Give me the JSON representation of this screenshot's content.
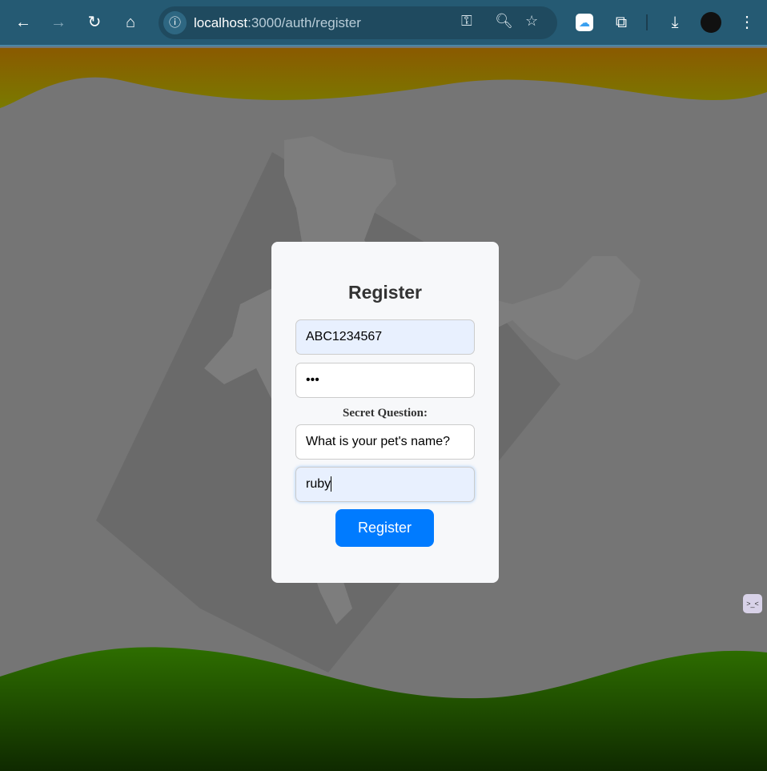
{
  "browser": {
    "url_host": "localhost",
    "url_rest": ":3000/auth/register"
  },
  "form": {
    "title": "Register",
    "username_value": "ABC1234567",
    "password_value": "•••",
    "secret_question_label": "Secret Question:",
    "secret_question_value": "What is your pet's name?",
    "secret_answer_value": "ruby",
    "submit_label": "Register"
  },
  "colors": {
    "accent": "#007bff",
    "top_wave": "#8a6a00",
    "bottom_wave": "#2e6a00"
  }
}
